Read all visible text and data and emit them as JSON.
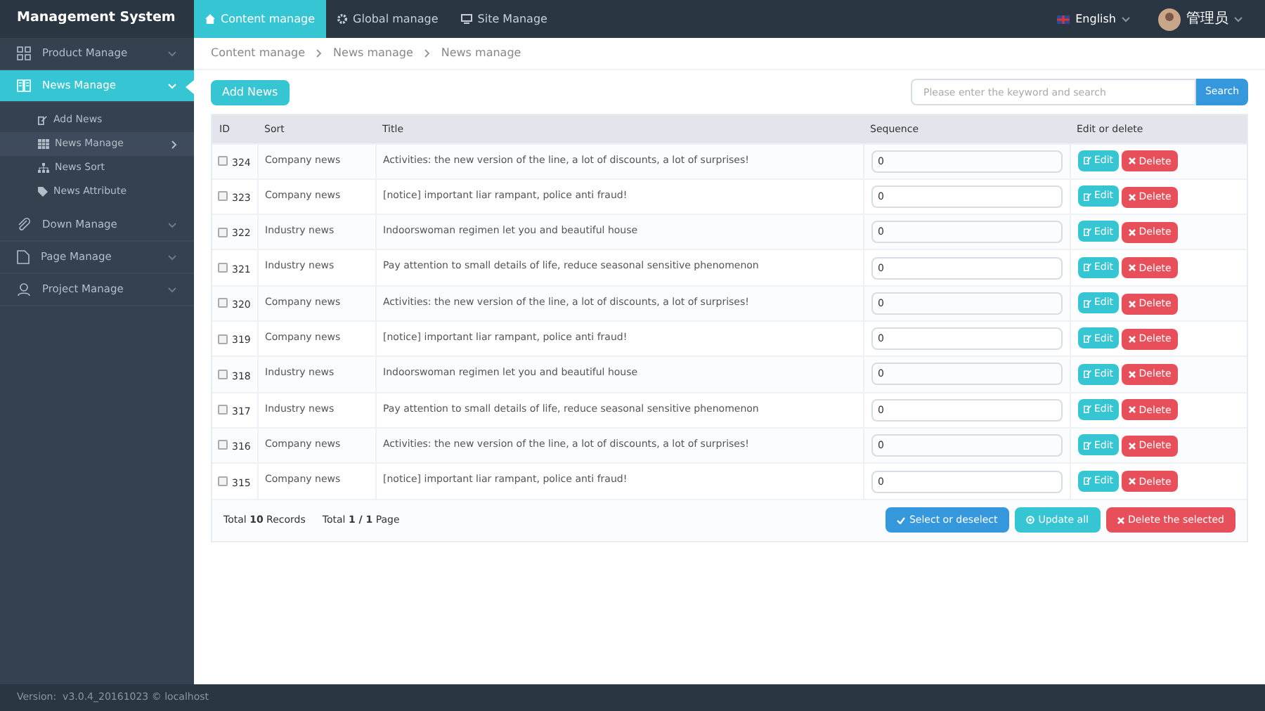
{
  "app_title": "Management System",
  "top_tabs": [
    {
      "label": "Content manage",
      "selected": true
    },
    {
      "label": "Global manage",
      "selected": false
    },
    {
      "label": "Site Manage",
      "selected": false
    }
  ],
  "language": "English",
  "user": "管理员",
  "sidebar": {
    "items": [
      {
        "label": "Product Manage",
        "selected": false,
        "expanded": false
      },
      {
        "label": "News Manage",
        "selected": true,
        "expanded": true,
        "children": [
          {
            "label": "Add News",
            "selected": false
          },
          {
            "label": "News Manage",
            "selected": true
          },
          {
            "label": "News Sort",
            "selected": false
          },
          {
            "label": "News Attribute",
            "selected": false
          }
        ]
      },
      {
        "label": "Down Manage",
        "selected": false,
        "expanded": false
      },
      {
        "label": "Page Manage",
        "selected": false,
        "expanded": false
      },
      {
        "label": "Project Manage",
        "selected": false,
        "expanded": false
      }
    ]
  },
  "breadcrumb": [
    "Content manage",
    "News manage",
    "News manage"
  ],
  "add_button": "Add News",
  "search": {
    "placeholder": "Please enter the keyword and search",
    "button": "Search"
  },
  "table": {
    "columns": [
      "ID",
      "Sort",
      "Title",
      "Sequence",
      "Edit or delete"
    ],
    "rows": [
      {
        "checked": false,
        "id": "324",
        "sort": "Company news",
        "title": "Activities: the new version of the line, a lot of discounts, a lot of surprises!",
        "sequence": "0",
        "edit": "Edit",
        "delete": "Delete"
      },
      {
        "checked": false,
        "id": "323",
        "sort": "Company news",
        "title": "[notice] important liar rampant, police anti fraud!",
        "sequence": "0",
        "edit": "Edit",
        "delete": "Delete"
      },
      {
        "checked": false,
        "id": "322",
        "sort": "Industry news",
        "title": "Indoorswoman regimen let you and beautiful house",
        "sequence": "0",
        "edit": "Edit",
        "delete": "Delete"
      },
      {
        "checked": false,
        "id": "321",
        "sort": "Industry news",
        "title": "Pay attention to small details of life, reduce seasonal sensitive phenomenon",
        "sequence": "0",
        "edit": "Edit",
        "delete": "Delete"
      },
      {
        "checked": false,
        "id": "320",
        "sort": "Company news",
        "title": "Activities: the new version of the line, a lot of discounts, a lot of surprises!",
        "sequence": "0",
        "edit": "Edit",
        "delete": "Delete"
      },
      {
        "checked": false,
        "id": "319",
        "sort": "Company news",
        "title": "[notice] important liar rampant, police anti fraud!",
        "sequence": "0",
        "edit": "Edit",
        "delete": "Delete"
      },
      {
        "checked": false,
        "id": "318",
        "sort": "Industry news",
        "title": "Indoorswoman regimen let you and beautiful house",
        "sequence": "0",
        "edit": "Edit",
        "delete": "Delete"
      },
      {
        "checked": false,
        "id": "317",
        "sort": "Industry news",
        "title": "Pay attention to small details of life, reduce seasonal sensitive phenomenon",
        "sequence": "0",
        "edit": "Edit",
        "delete": "Delete"
      },
      {
        "checked": false,
        "id": "316",
        "sort": "Company news",
        "title": "Activities: the new version of the line, a lot of discounts, a lot of surprises!",
        "sequence": "0",
        "edit": "Edit",
        "delete": "Delete"
      },
      {
        "checked": false,
        "id": "315",
        "sort": "Company news",
        "title": "[notice] important liar rampant, police anti fraud!",
        "sequence": "0",
        "edit": "Edit",
        "delete": "Delete"
      }
    ]
  },
  "records": "Total **10** Records",
  "pages": "Total **1 / 1** Page",
  "actions": [
    {
      "kind": "select",
      "label": "Select or deselect"
    },
    {
      "kind": "update",
      "label": "Update all"
    },
    {
      "kind": "delete",
      "label": "Delete the selected"
    }
  ],
  "version": "Version:  v3.0.4_20161023 © localhost"
}
